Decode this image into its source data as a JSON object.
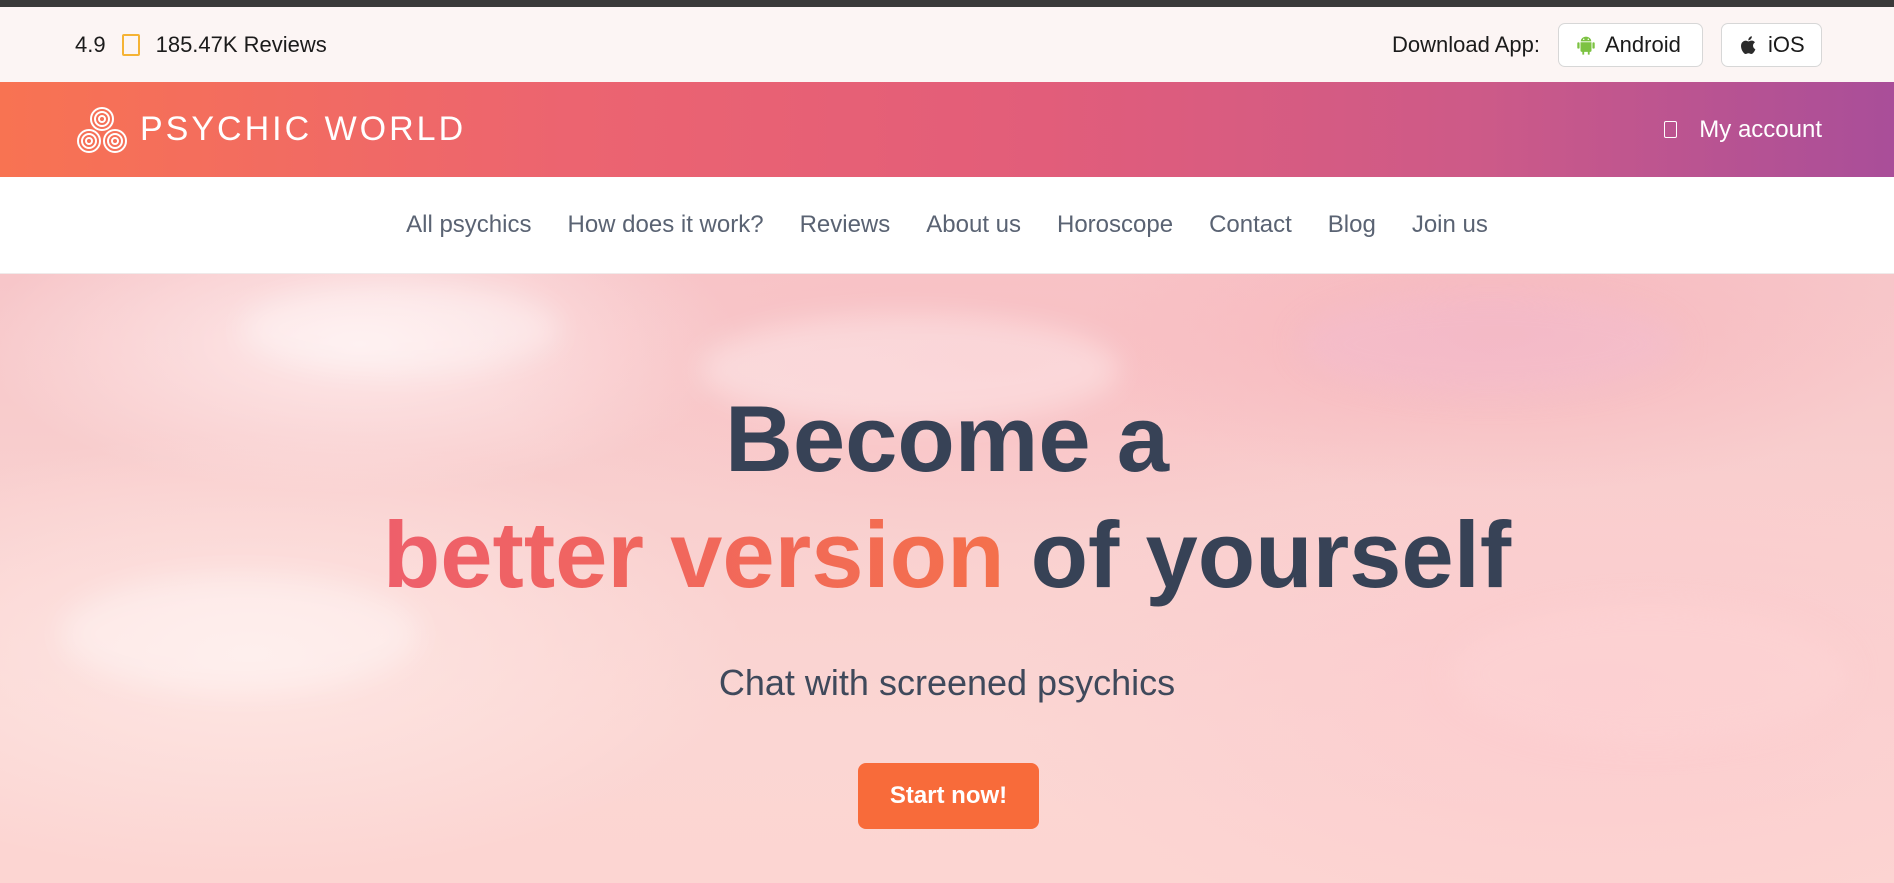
{
  "infobar": {
    "rating": "4.9",
    "reviews": "185.47K Reviews",
    "download_label": "Download App:",
    "android_label": "Android",
    "ios_label": "iOS"
  },
  "header": {
    "brand": "PSYCHIC WORLD",
    "account_label": "My account"
  },
  "nav": {
    "items": [
      "All psychics",
      "How does it work?",
      "Reviews",
      "About us",
      "Horoscope",
      "Contact",
      "Blog",
      "Join us"
    ]
  },
  "hero": {
    "line1": "Become a",
    "accent": "better version",
    "line2_rest": " of yourself",
    "subtitle": "Chat with screened psychics",
    "cta": "Start now!"
  },
  "colors": {
    "header_gradient_start": "#f87352",
    "header_gradient_end": "#a94e99",
    "accent": "#f4704c",
    "cta": "#f86b3a",
    "headline": "#374256",
    "star": "#f5b335"
  },
  "icons": {
    "rating": "star-icon",
    "android": "android-icon",
    "ios": "apple-icon",
    "logo": "triple-spiral-icon",
    "account": "user-icon"
  }
}
